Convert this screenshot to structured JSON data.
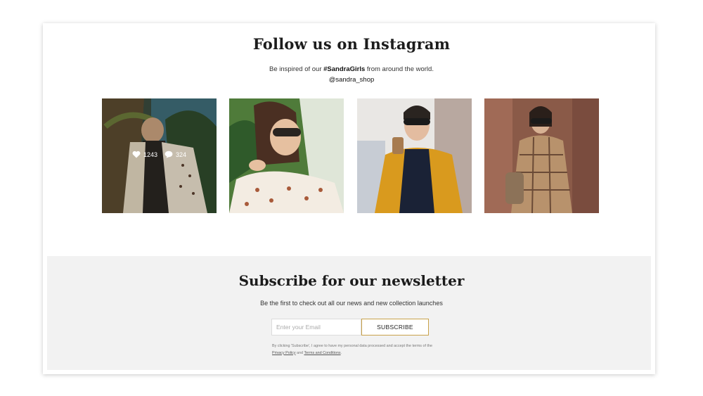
{
  "instagram": {
    "title": "Follow us on Instagram",
    "subtitle_prefix": "Be inspired of our ",
    "hashtag": "#SandraGirls",
    "subtitle_suffix": " from around the world.",
    "handle": "@sandra_shop",
    "posts": [
      {
        "likes": "1243",
        "comments": "324"
      },
      {},
      {},
      {}
    ]
  },
  "newsletter": {
    "title": "Subscribe for our newsletter",
    "subtitle": "Be the first to check out all our news and new collection launches",
    "email_placeholder": "Enter your Email",
    "subscribe_label": "SUBSCRIBE",
    "legal_prefix": "By clicking 'Subscribe', I agree to have my personal data processed and accept the terms of the ",
    "privacy_link": "Privacy Policy",
    "legal_and": " and ",
    "terms_link": "Terms and Conditions",
    "legal_suffix": "."
  },
  "colors": {
    "accent_gold": "#c9a24a",
    "panel_bg": "#f2f2f2"
  },
  "icons": {
    "like": "heart-icon",
    "comment": "comment-icon"
  }
}
